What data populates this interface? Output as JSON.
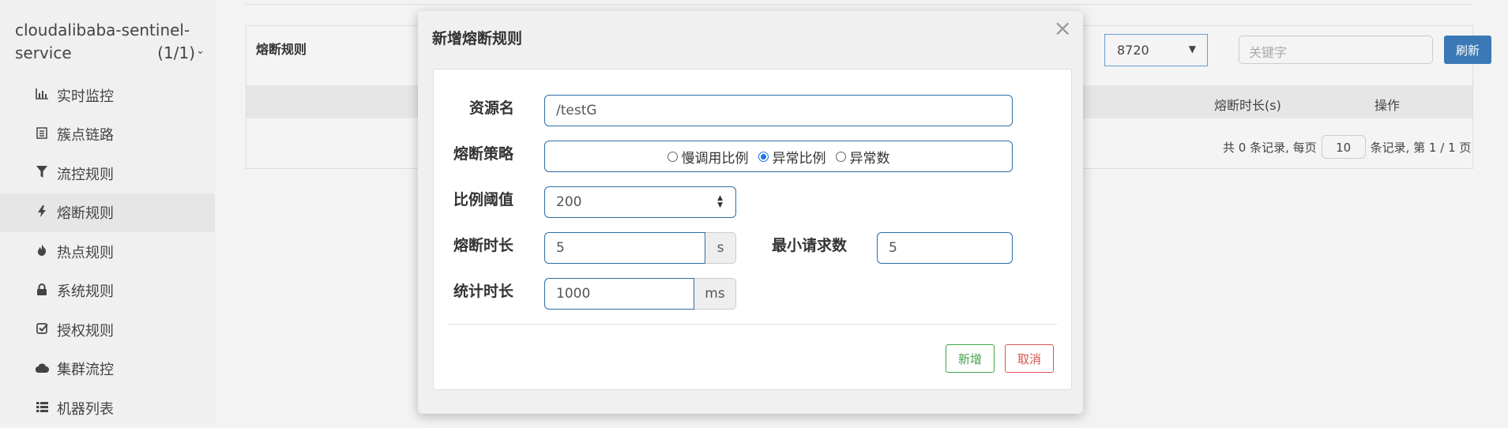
{
  "sidebar": {
    "app_name": "cloudalibaba-sentinel-service",
    "app_count": "(1/1)",
    "items": [
      {
        "label": "实时监控",
        "icon": "bar-chart-icon"
      },
      {
        "label": "簇点链路",
        "icon": "list-icon"
      },
      {
        "label": "流控规则",
        "icon": "filter-icon"
      },
      {
        "label": "熔断规则",
        "icon": "flash-icon"
      },
      {
        "label": "热点规则",
        "icon": "fire-icon"
      },
      {
        "label": "系统规则",
        "icon": "lock-icon"
      },
      {
        "label": "授权规则",
        "icon": "check-square-icon"
      },
      {
        "label": "集群流控",
        "icon": "cloud-icon"
      },
      {
        "label": "机器列表",
        "icon": "th-list-icon"
      }
    ]
  },
  "main": {
    "panel_title": "熔断规则",
    "machine_value": "8720",
    "keyword_placeholder": "关键字",
    "refresh_label": "刷新",
    "columns": {
      "duration": "熔断时长(s)",
      "ops": "操作"
    },
    "pager": {
      "prefix": "共 0 条记录, 每页",
      "page_size": "10",
      "suffix": "条记录, 第 1 / 1 页"
    }
  },
  "modal": {
    "title": "新增熔断规则",
    "close": "×",
    "resource_label": "资源名",
    "resource_value": "/testG",
    "strategy_label": "熔断策略",
    "strategies": [
      "慢调用比例",
      "异常比例",
      "异常数"
    ],
    "selected_strategy": "异常比例",
    "threshold_label": "比例阈值",
    "threshold_value": "200",
    "duration_label": "熔断时长",
    "duration_value": "5",
    "duration_unit": "s",
    "min_request_label": "最小请求数",
    "min_request_value": "5",
    "stat_label": "统计时长",
    "stat_value": "1000",
    "stat_unit": "ms",
    "add_label": "新增",
    "cancel_label": "取消"
  }
}
